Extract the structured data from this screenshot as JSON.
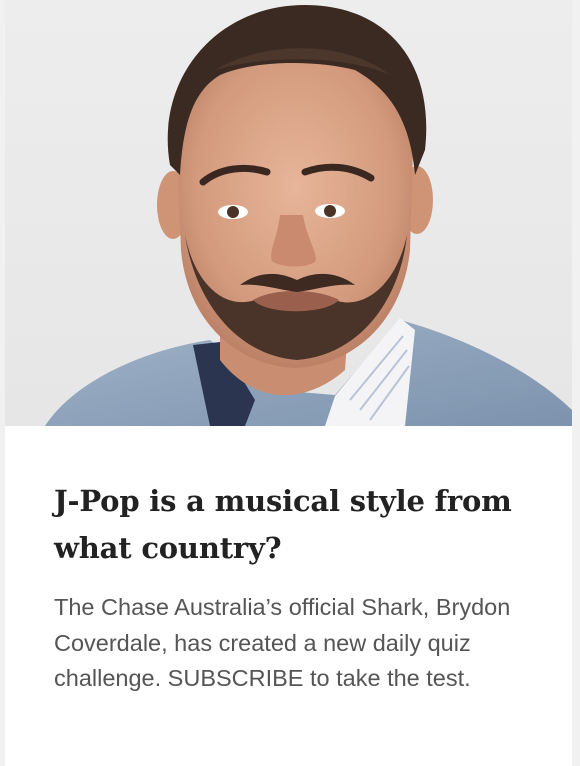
{
  "article": {
    "image_alt": "Portrait of Brydon Coverdale",
    "headline": "J-Pop is a musical style from what country?",
    "summary": "The Chase Australia’s official Shark, Brydon Coverdale, has created a new daily quiz challenge. SUBSCRIBE to take the test."
  },
  "colors": {
    "headline": "#222222",
    "summary": "#555555",
    "background": "#f1f1f1",
    "card": "#ffffff"
  }
}
